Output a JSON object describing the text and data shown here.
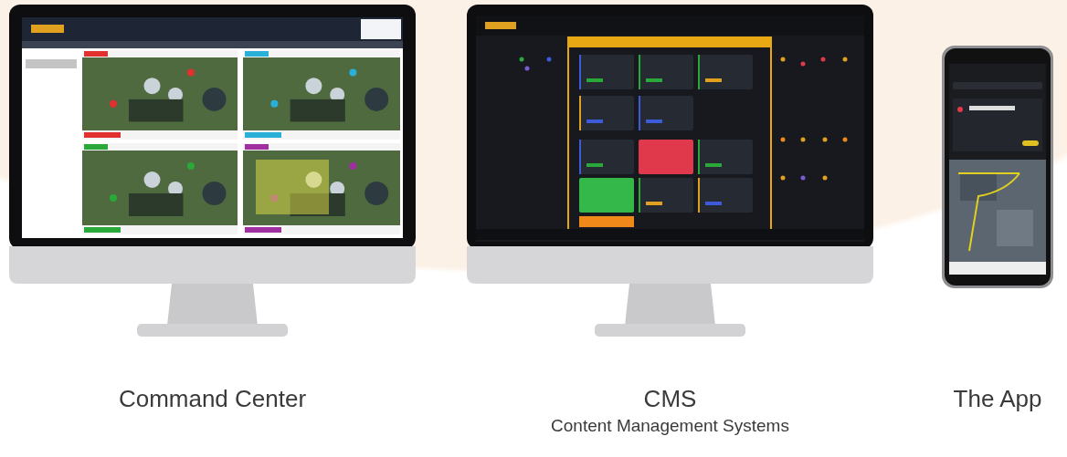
{
  "products": [
    {
      "kind": "monitor-map",
      "title": "Command Center"
    },
    {
      "kind": "monitor-schedule",
      "title": "CMS",
      "subtitle": "Content Management Systems"
    },
    {
      "kind": "phone",
      "title": "The App"
    }
  ]
}
